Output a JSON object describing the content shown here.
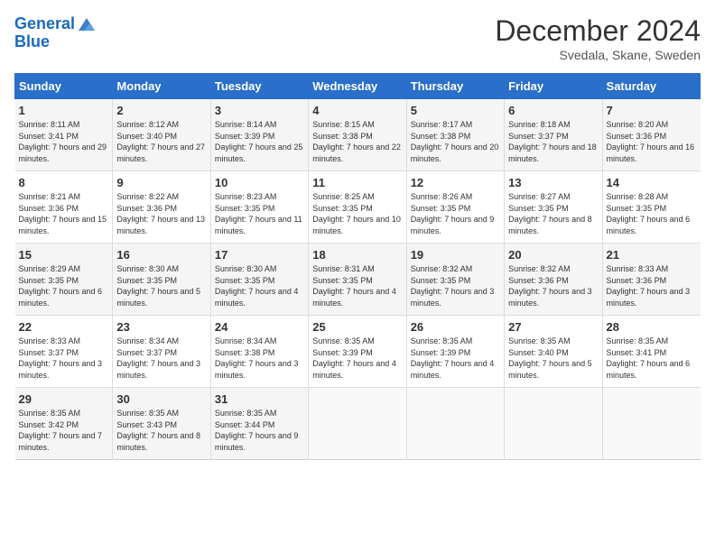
{
  "header": {
    "logo_line1": "General",
    "logo_line2": "Blue",
    "month": "December 2024",
    "location": "Svedala, Skane, Sweden"
  },
  "days_of_week": [
    "Sunday",
    "Monday",
    "Tuesday",
    "Wednesday",
    "Thursday",
    "Friday",
    "Saturday"
  ],
  "weeks": [
    [
      {
        "num": "1",
        "sunrise": "8:11 AM",
        "sunset": "3:41 PM",
        "daylight": "7 hours and 29 minutes."
      },
      {
        "num": "2",
        "sunrise": "8:12 AM",
        "sunset": "3:40 PM",
        "daylight": "7 hours and 27 minutes."
      },
      {
        "num": "3",
        "sunrise": "8:14 AM",
        "sunset": "3:39 PM",
        "daylight": "7 hours and 25 minutes."
      },
      {
        "num": "4",
        "sunrise": "8:15 AM",
        "sunset": "3:38 PM",
        "daylight": "7 hours and 22 minutes."
      },
      {
        "num": "5",
        "sunrise": "8:17 AM",
        "sunset": "3:38 PM",
        "daylight": "7 hours and 20 minutes."
      },
      {
        "num": "6",
        "sunrise": "8:18 AM",
        "sunset": "3:37 PM",
        "daylight": "7 hours and 18 minutes."
      },
      {
        "num": "7",
        "sunrise": "8:20 AM",
        "sunset": "3:36 PM",
        "daylight": "7 hours and 16 minutes."
      }
    ],
    [
      {
        "num": "8",
        "sunrise": "8:21 AM",
        "sunset": "3:36 PM",
        "daylight": "7 hours and 15 minutes."
      },
      {
        "num": "9",
        "sunrise": "8:22 AM",
        "sunset": "3:36 PM",
        "daylight": "7 hours and 13 minutes."
      },
      {
        "num": "10",
        "sunrise": "8:23 AM",
        "sunset": "3:35 PM",
        "daylight": "7 hours and 11 minutes."
      },
      {
        "num": "11",
        "sunrise": "8:25 AM",
        "sunset": "3:35 PM",
        "daylight": "7 hours and 10 minutes."
      },
      {
        "num": "12",
        "sunrise": "8:26 AM",
        "sunset": "3:35 PM",
        "daylight": "7 hours and 9 minutes."
      },
      {
        "num": "13",
        "sunrise": "8:27 AM",
        "sunset": "3:35 PM",
        "daylight": "7 hours and 8 minutes."
      },
      {
        "num": "14",
        "sunrise": "8:28 AM",
        "sunset": "3:35 PM",
        "daylight": "7 hours and 6 minutes."
      }
    ],
    [
      {
        "num": "15",
        "sunrise": "8:29 AM",
        "sunset": "3:35 PM",
        "daylight": "7 hours and 6 minutes."
      },
      {
        "num": "16",
        "sunrise": "8:30 AM",
        "sunset": "3:35 PM",
        "daylight": "7 hours and 5 minutes."
      },
      {
        "num": "17",
        "sunrise": "8:30 AM",
        "sunset": "3:35 PM",
        "daylight": "7 hours and 4 minutes."
      },
      {
        "num": "18",
        "sunrise": "8:31 AM",
        "sunset": "3:35 PM",
        "daylight": "7 hours and 4 minutes."
      },
      {
        "num": "19",
        "sunrise": "8:32 AM",
        "sunset": "3:35 PM",
        "daylight": "7 hours and 3 minutes."
      },
      {
        "num": "20",
        "sunrise": "8:32 AM",
        "sunset": "3:36 PM",
        "daylight": "7 hours and 3 minutes."
      },
      {
        "num": "21",
        "sunrise": "8:33 AM",
        "sunset": "3:36 PM",
        "daylight": "7 hours and 3 minutes."
      }
    ],
    [
      {
        "num": "22",
        "sunrise": "8:33 AM",
        "sunset": "3:37 PM",
        "daylight": "7 hours and 3 minutes."
      },
      {
        "num": "23",
        "sunrise": "8:34 AM",
        "sunset": "3:37 PM",
        "daylight": "7 hours and 3 minutes."
      },
      {
        "num": "24",
        "sunrise": "8:34 AM",
        "sunset": "3:38 PM",
        "daylight": "7 hours and 3 minutes."
      },
      {
        "num": "25",
        "sunrise": "8:35 AM",
        "sunset": "3:39 PM",
        "daylight": "7 hours and 4 minutes."
      },
      {
        "num": "26",
        "sunrise": "8:35 AM",
        "sunset": "3:39 PM",
        "daylight": "7 hours and 4 minutes."
      },
      {
        "num": "27",
        "sunrise": "8:35 AM",
        "sunset": "3:40 PM",
        "daylight": "7 hours and 5 minutes."
      },
      {
        "num": "28",
        "sunrise": "8:35 AM",
        "sunset": "3:41 PM",
        "daylight": "7 hours and 6 minutes."
      }
    ],
    [
      {
        "num": "29",
        "sunrise": "8:35 AM",
        "sunset": "3:42 PM",
        "daylight": "7 hours and 7 minutes."
      },
      {
        "num": "30",
        "sunrise": "8:35 AM",
        "sunset": "3:43 PM",
        "daylight": "7 hours and 8 minutes."
      },
      {
        "num": "31",
        "sunrise": "8:35 AM",
        "sunset": "3:44 PM",
        "daylight": "7 hours and 9 minutes."
      },
      null,
      null,
      null,
      null
    ]
  ]
}
